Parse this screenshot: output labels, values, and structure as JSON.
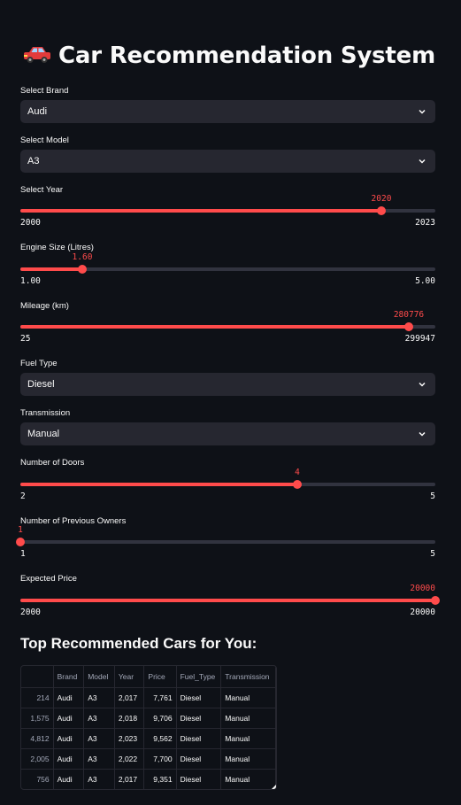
{
  "title": "Car Recommendation System",
  "title_icon": "car-emoji",
  "form": {
    "brand": {
      "label": "Select Brand",
      "value": "Audi"
    },
    "model": {
      "label": "Select Model",
      "value": "A3"
    },
    "year": {
      "label": "Select Year",
      "value": "2020",
      "min": "2000",
      "max": "2023",
      "fraction": 0.87
    },
    "engine": {
      "label": "Engine Size (Litres)",
      "value": "1.60",
      "min": "1.00",
      "max": "5.00",
      "fraction": 0.15
    },
    "mileage": {
      "label": "Mileage (km)",
      "value": "280776",
      "min": "25",
      "max": "299947",
      "fraction": 0.936
    },
    "fuel": {
      "label": "Fuel Type",
      "value": "Diesel"
    },
    "transmission": {
      "label": "Transmission",
      "value": "Manual"
    },
    "doors": {
      "label": "Number of Doors",
      "value": "4",
      "min": "2",
      "max": "5",
      "fraction": 0.667
    },
    "owners": {
      "label": "Number of Previous Owners",
      "value": "1",
      "min": "1",
      "max": "5",
      "fraction": 0.0
    },
    "price": {
      "label": "Expected Price",
      "value": "20000",
      "min": "2000",
      "max": "20000",
      "fraction": 1.0
    }
  },
  "results": {
    "heading": "Top Recommended Cars for You:",
    "columns": [
      "",
      "Brand",
      "Model",
      "Year",
      "Price",
      "Fuel_Type",
      "Transmission"
    ],
    "rows": [
      [
        "214",
        "Audi",
        "A3",
        "2,017",
        "7,761",
        "Diesel",
        "Manual"
      ],
      [
        "1,575",
        "Audi",
        "A3",
        "2,018",
        "9,706",
        "Diesel",
        "Manual"
      ],
      [
        "4,812",
        "Audi",
        "A3",
        "2,023",
        "9,562",
        "Diesel",
        "Manual"
      ],
      [
        "2,005",
        "Audi",
        "A3",
        "2,022",
        "7,700",
        "Diesel",
        "Manual"
      ],
      [
        "756",
        "Audi",
        "A3",
        "2,017",
        "9,351",
        "Diesel",
        "Manual"
      ]
    ]
  },
  "colors": {
    "background": "#0e1117",
    "accent": "#ff4b4b",
    "widget": "#262730",
    "track": "#31333f"
  }
}
